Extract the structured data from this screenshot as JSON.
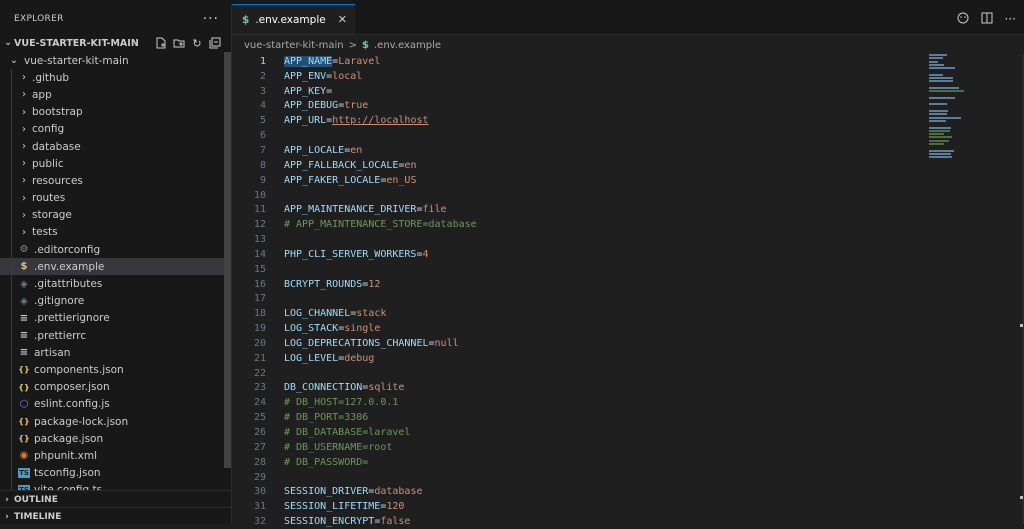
{
  "explorer": {
    "title": "EXPLORER",
    "more": "···",
    "root": "VUE-STARTER-KIT-MAIN",
    "folder": "vue-starter-kit-main",
    "items": [
      {
        "label": ".github",
        "kind": "folder"
      },
      {
        "label": "app",
        "kind": "folder"
      },
      {
        "label": "bootstrap",
        "kind": "folder"
      },
      {
        "label": "config",
        "kind": "folder"
      },
      {
        "label": "database",
        "kind": "folder"
      },
      {
        "label": "public",
        "kind": "folder"
      },
      {
        "label": "resources",
        "kind": "folder"
      },
      {
        "label": "routes",
        "kind": "folder"
      },
      {
        "label": "storage",
        "kind": "folder"
      },
      {
        "label": "tests",
        "kind": "folder"
      },
      {
        "label": ".editorconfig",
        "kind": "gear",
        "color": "#8a8a8a"
      },
      {
        "label": ".env.example",
        "kind": "dollar",
        "color": "#e5c07b",
        "selected": true
      },
      {
        "label": ".gitattributes",
        "kind": "diamond",
        "color": "#6d8086"
      },
      {
        "label": ".gitignore",
        "kind": "diamond",
        "color": "#6d8086"
      },
      {
        "label": ".prettierignore",
        "kind": "lines",
        "color": "#cccccc"
      },
      {
        "label": ".prettierrc",
        "kind": "lines",
        "color": "#cccccc"
      },
      {
        "label": "artisan",
        "kind": "lines",
        "color": "#cccccc"
      },
      {
        "label": "components.json",
        "kind": "braces",
        "color": "#e5c07b"
      },
      {
        "label": "composer.json",
        "kind": "braces",
        "color": "#e5c07b"
      },
      {
        "label": "eslint.config.js",
        "kind": "eslint",
        "color": "#8080f2"
      },
      {
        "label": "package-lock.json",
        "kind": "braces",
        "color": "#e5c07b"
      },
      {
        "label": "package.json",
        "kind": "braces",
        "color": "#e5c07b"
      },
      {
        "label": "phpunit.xml",
        "kind": "rss",
        "color": "#e37933"
      },
      {
        "label": "tsconfig.json",
        "kind": "ts",
        "color": "#519aba"
      },
      {
        "label": "vite.config.ts",
        "kind": "ts",
        "color": "#519aba"
      }
    ],
    "sections": [
      "OUTLINE",
      "TIMELINE"
    ]
  },
  "tab": {
    "label": ".env.example"
  },
  "breadcrumb": {
    "root": "vue-starter-kit-main",
    "sep": ">",
    "file": ".env.example"
  },
  "code": [
    {
      "n": "1",
      "key": "APP_NAME",
      "val": "Laravel",
      "type": "kv"
    },
    {
      "n": "2",
      "key": "APP_ENV",
      "val": "local",
      "type": "kv"
    },
    {
      "n": "3",
      "key": "APP_KEY",
      "val": "",
      "type": "kv"
    },
    {
      "n": "4",
      "key": "APP_DEBUG",
      "val": "true",
      "type": "kv"
    },
    {
      "n": "5",
      "key": "APP_URL",
      "val": "http://localhost",
      "type": "url"
    },
    {
      "n": "6",
      "type": "blank"
    },
    {
      "n": "7",
      "key": "APP_LOCALE",
      "val": "en",
      "type": "kv"
    },
    {
      "n": "8",
      "key": "APP_FALLBACK_LOCALE",
      "val": "en",
      "type": "kv"
    },
    {
      "n": "9",
      "key": "APP_FAKER_LOCALE",
      "val": "en_US",
      "type": "kv"
    },
    {
      "n": "10",
      "type": "blank"
    },
    {
      "n": "11",
      "key": "APP_MAINTENANCE_DRIVER",
      "val": "file",
      "type": "kv"
    },
    {
      "n": "12",
      "text": "# APP_MAINTENANCE_STORE=database",
      "type": "comment"
    },
    {
      "n": "13",
      "type": "blank"
    },
    {
      "n": "14",
      "key": "PHP_CLI_SERVER_WORKERS",
      "val": "4",
      "type": "kv"
    },
    {
      "n": "15",
      "type": "blank"
    },
    {
      "n": "16",
      "key": "BCRYPT_ROUNDS",
      "val": "12",
      "type": "kv"
    },
    {
      "n": "17",
      "type": "blank"
    },
    {
      "n": "18",
      "key": "LOG_CHANNEL",
      "val": "stack",
      "type": "kv"
    },
    {
      "n": "19",
      "key": "LOG_STACK",
      "val": "single",
      "type": "kv"
    },
    {
      "n": "20",
      "key": "LOG_DEPRECATIONS_CHANNEL",
      "val": "null",
      "type": "kv"
    },
    {
      "n": "21",
      "key": "LOG_LEVEL",
      "val": "debug",
      "type": "kv"
    },
    {
      "n": "22",
      "type": "blank"
    },
    {
      "n": "23",
      "key": "DB_CONNECTION",
      "val": "sqlite",
      "type": "kv"
    },
    {
      "n": "24",
      "text": "# DB_HOST=127.0.0.1",
      "type": "comment"
    },
    {
      "n": "25",
      "text": "# DB_PORT=3306",
      "type": "comment"
    },
    {
      "n": "26",
      "text": "# DB_DATABASE=laravel",
      "type": "comment"
    },
    {
      "n": "27",
      "text": "# DB_USERNAME=root",
      "type": "comment"
    },
    {
      "n": "28",
      "text": "# DB_PASSWORD=",
      "type": "comment"
    },
    {
      "n": "29",
      "type": "blank"
    },
    {
      "n": "30",
      "key": "SESSION_DRIVER",
      "val": "database",
      "type": "kv"
    },
    {
      "n": "31",
      "key": "SESSION_LIFETIME",
      "val": "120",
      "type": "kv"
    },
    {
      "n": "32",
      "key": "SESSION_ENCRYPT",
      "val": "false",
      "type": "kv"
    }
  ],
  "colors": {
    "accent": "#0078d4",
    "key": "#9cdcfe",
    "value": "#ce9178",
    "comment": "#6a9955"
  }
}
